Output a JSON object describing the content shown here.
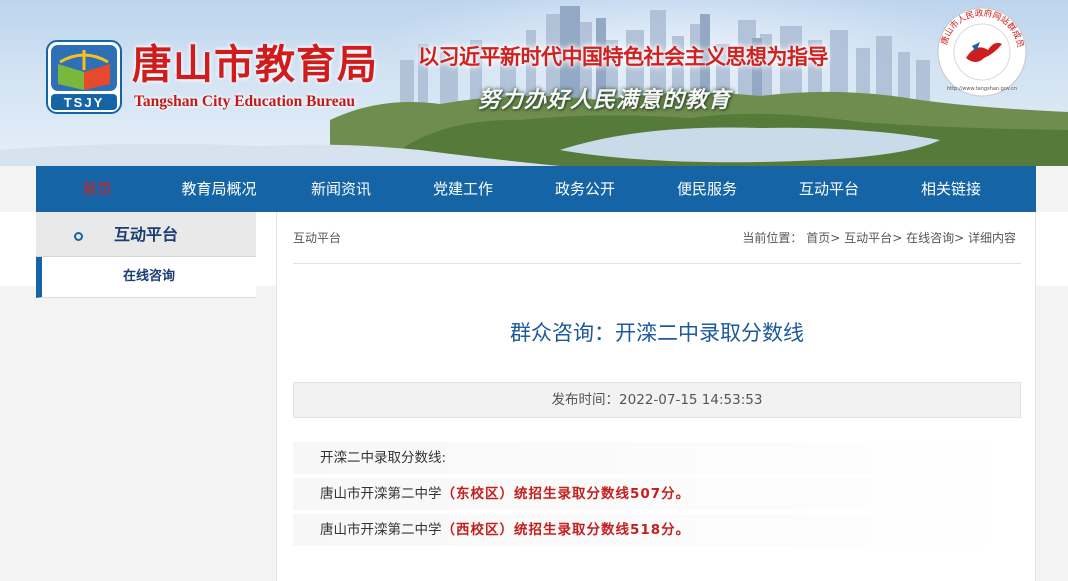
{
  "header": {
    "logo_text": "TSJY",
    "site_name_cn": "唐山市教育局",
    "site_name_en": "Tangshan City Education Bureau",
    "slogan_line1": "以习近平新时代中国特色社会主义思想为指导",
    "slogan_line2": "努力办好人民满意的教育",
    "seal_text": "唐山市人民政府网站群成员",
    "seal_url": "http://www.tangshan.gov.cn",
    "brand_color": "#cf1d1d"
  },
  "nav": {
    "items": [
      "首页",
      "教育局概况",
      "新闻资讯",
      "党建工作",
      "政务公开",
      "便民服务",
      "互动平台",
      "相关链接"
    ],
    "active_index": 0,
    "bg_color": "#1565a6"
  },
  "sidebar": {
    "title": "互动平台",
    "items": [
      "在线咨询"
    ]
  },
  "breadcrumb": {
    "section": "互动平台",
    "prefix": "当前位置：",
    "path": [
      "首页",
      "互动平台",
      "在线咨询",
      "详细内容"
    ],
    "separator": ">"
  },
  "article": {
    "title": "群众咨询：开滦二中录取分数线",
    "publish_label": "发布时间：",
    "publish_time": "2022-07-15 14:53:53",
    "paragraphs": [
      {
        "plain": "开滦二中录取分数线:",
        "highlight": ""
      },
      {
        "plain": "唐山市开滦第二中学",
        "highlight": "（东校区）统招生录取分数线507分。"
      },
      {
        "plain": "唐山市开滦第二中学",
        "highlight": "（西校区）统招生录取分数线518分。"
      }
    ]
  }
}
